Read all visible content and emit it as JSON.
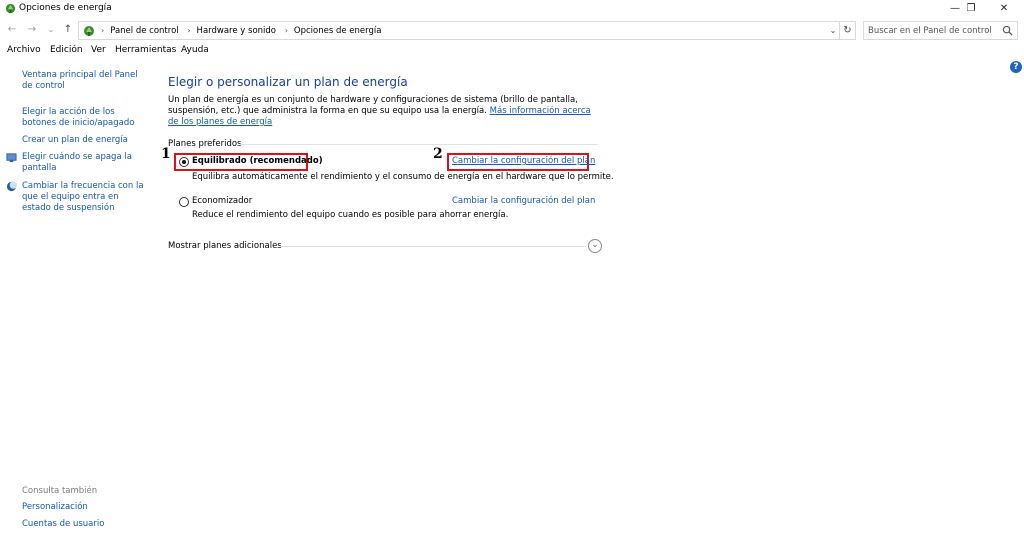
{
  "window": {
    "title": "Opciones de energía",
    "minimize": "—",
    "maximize": "❐",
    "close": "✕"
  },
  "nav": {
    "back": "←",
    "forward": "→",
    "recent": "⌄",
    "up": "↑"
  },
  "address": {
    "crumbs": [
      "Panel de control",
      "Hardware y sonido",
      "Opciones de energía"
    ],
    "separator": "›",
    "dropdown": "⌄",
    "refresh": "↻"
  },
  "search": {
    "placeholder": "Buscar en el Panel de control"
  },
  "menu": [
    "Archivo",
    "Edición",
    "Ver",
    "Herramientas",
    "Ayuda"
  ],
  "help": "?",
  "sidebar": {
    "items": [
      "Ventana principal del Panel de control",
      "Elegir la acción de los botones de inicio/apagado",
      "Crear un plan de energía",
      "Elegir cuándo se apaga la pantalla",
      "Cambiar la frecuencia con la que el equipo entra en estado de suspensión"
    ],
    "see_also_label": "Consulta también",
    "see_also": [
      "Personalización",
      "Cuentas de usuario"
    ]
  },
  "main": {
    "title": "Elegir o personalizar un plan de energía",
    "description": "Un plan de energía es un conjunto de hardware y configuraciones de sistema (brillo de pantalla, suspensión, etc.) que administra la forma en que su equipo usa la energía.",
    "more_info_link": "Más información acerca de los planes de energía",
    "preferred_label": "Planes preferidos",
    "plans": [
      {
        "name": "Equilibrado (recomendado)",
        "description": "Equilibra automáticamente el rendimiento y el consumo de energía en el hardware que lo permite.",
        "link": "Cambiar la configuración del plan",
        "selected": true
      },
      {
        "name": "Economizador",
        "description": "Reduce el rendimiento del equipo cuando es posible para ahorrar energía.",
        "link": "Cambiar la configuración del plan",
        "selected": false
      }
    ],
    "more_plans": "Mostrar planes adicionales",
    "expand": "⌄"
  },
  "annotations": {
    "callout_1": "1",
    "callout_2": "2",
    "color": "#e0101b"
  }
}
